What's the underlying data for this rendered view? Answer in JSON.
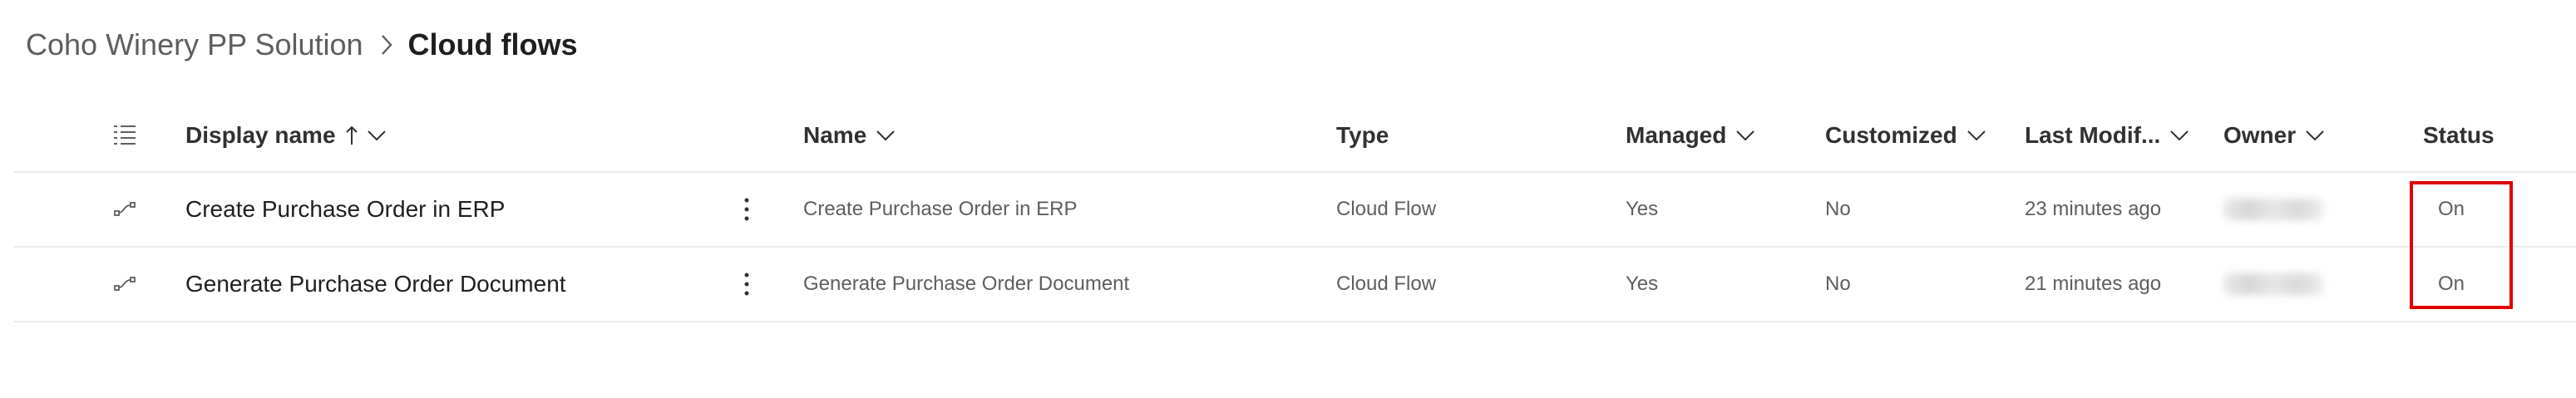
{
  "breadcrumb": {
    "solution": "Coho Winery PP Solution",
    "current": "Cloud flows",
    "separator_icon": "chevron-right-icon"
  },
  "grid": {
    "headers": {
      "display_name": "Display name",
      "name": "Name",
      "type": "Type",
      "managed": "Managed",
      "customized": "Customized",
      "last_modified": "Last Modif...",
      "owner": "Owner",
      "status": "Status"
    },
    "sort": {
      "column": "Display name",
      "direction": "ascending",
      "icon": "arrow-up-icon"
    },
    "rows": [
      {
        "display_name": "Create Purchase Order in ERP",
        "name": "Create Purchase Order in ERP",
        "type": "Cloud Flow",
        "managed": "Yes",
        "customized": "No",
        "last_modified": "23 minutes ago",
        "owner_blurred": true,
        "status": "On"
      },
      {
        "display_name": "Generate Purchase Order Document",
        "name": "Generate Purchase Order Document",
        "type": "Cloud Flow",
        "managed": "Yes",
        "customized": "No",
        "last_modified": "21 minutes ago",
        "owner_blurred": true,
        "status": "On"
      }
    ]
  },
  "annotation": {
    "color": "#e00000",
    "target": "Status"
  },
  "colors": {
    "text_primary": "#201f1e",
    "text_secondary": "#605e5c",
    "divider": "#edebe9"
  }
}
